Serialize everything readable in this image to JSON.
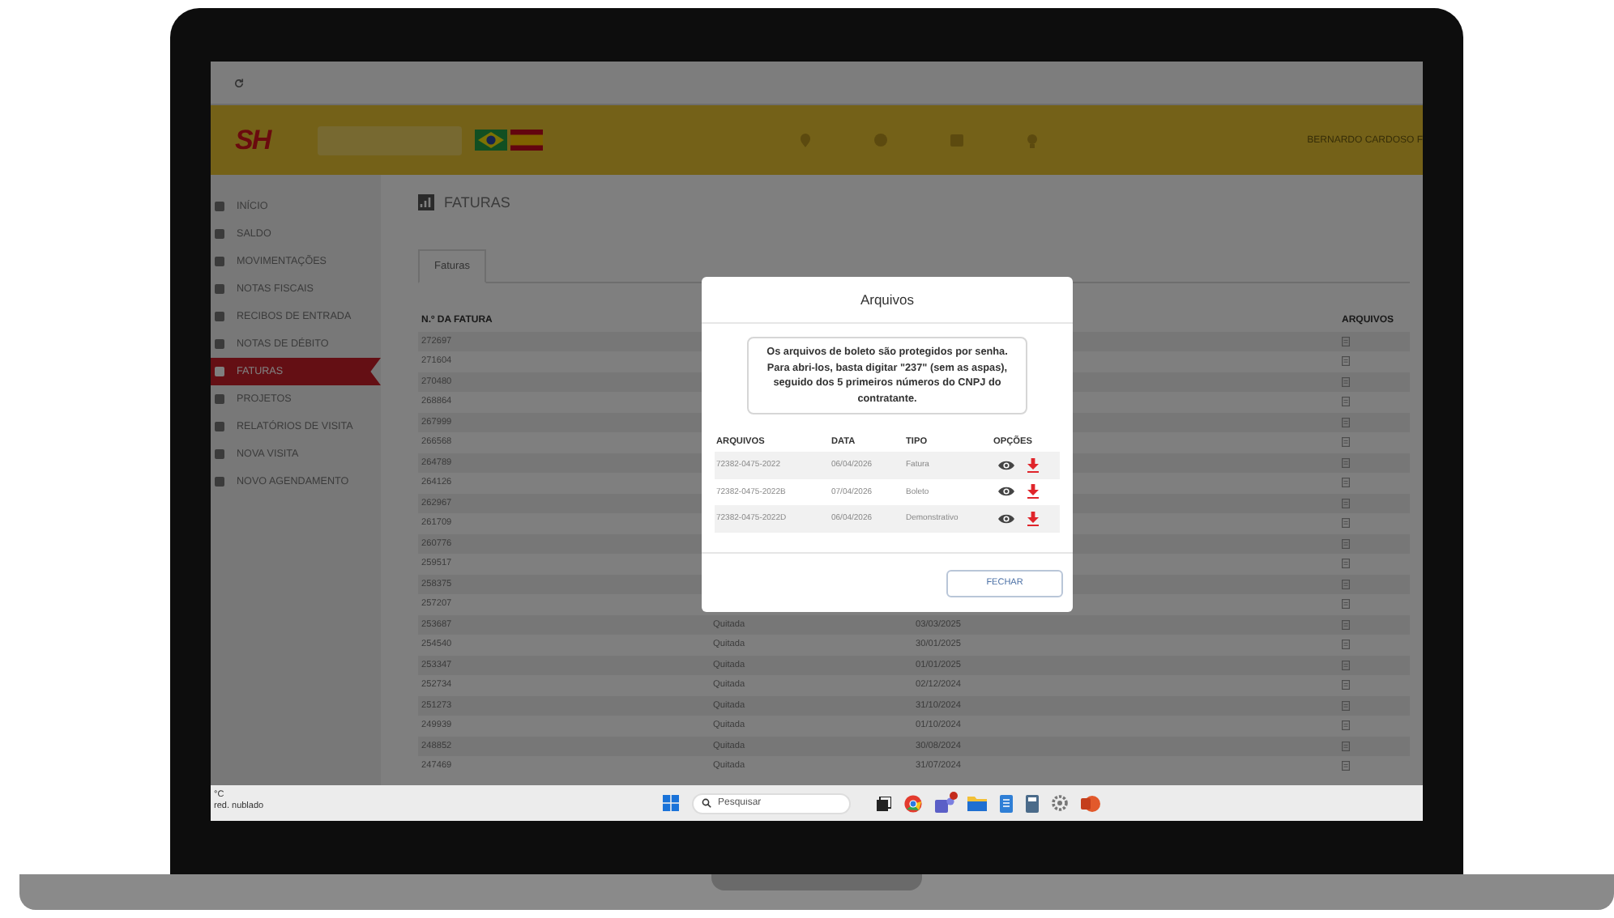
{
  "header": {
    "logo": "SH",
    "user": "BERNARDO CARDOSO F"
  },
  "sidebar": {
    "items": [
      {
        "label": "INÍCIO",
        "selected": false
      },
      {
        "label": "SALDO",
        "selected": false
      },
      {
        "label": "MOVIMENTAÇÕES",
        "selected": false
      },
      {
        "label": "NOTAS FISCAIS",
        "selected": false
      },
      {
        "label": "RECIBOS DE ENTRADA",
        "selected": false
      },
      {
        "label": "NOTAS DE DÉBITO",
        "selected": false
      },
      {
        "label": "FATURAS",
        "selected": true
      },
      {
        "label": "PROJETOS",
        "selected": false
      },
      {
        "label": "RELATÓRIOS DE VISITA",
        "selected": false
      },
      {
        "label": "NOVA VISITA",
        "selected": false
      },
      {
        "label": "NOVO AGENDAMENTO",
        "selected": false
      }
    ]
  },
  "page": {
    "title": "FATURAS",
    "tabs": [
      {
        "label": "Faturas",
        "selected": true
      }
    ]
  },
  "table": {
    "columns": [
      "N.º DA FATURA",
      "ARQUIVOS"
    ],
    "rows": [
      {
        "number": "272697"
      },
      {
        "number": "271604"
      },
      {
        "number": "270480"
      },
      {
        "number": "268864"
      },
      {
        "number": "267999"
      },
      {
        "number": "266568"
      },
      {
        "number": "264789"
      },
      {
        "number": "264126"
      },
      {
        "number": "262967"
      },
      {
        "number": "261709"
      },
      {
        "number": "260776"
      },
      {
        "number": "259517"
      },
      {
        "number": "258375"
      },
      {
        "number": "257207"
      },
      {
        "number": "253687",
        "status": "Quitada",
        "date": "03/03/2025"
      },
      {
        "number": "254540",
        "status": "Quitada",
        "date": "30/01/2025"
      },
      {
        "number": "253347",
        "status": "Quitada",
        "date": "01/01/2025"
      },
      {
        "number": "252734",
        "status": "Quitada",
        "date": "02/12/2024"
      },
      {
        "number": "251273",
        "status": "Quitada",
        "date": "31/10/2024"
      },
      {
        "number": "249939",
        "status": "Quitada",
        "date": "01/10/2024"
      },
      {
        "number": "248852",
        "status": "Quitada",
        "date": "30/08/2024"
      },
      {
        "number": "247469",
        "status": "Quitada",
        "date": "31/07/2024"
      }
    ]
  },
  "modal": {
    "title": "Arquivos",
    "notice": "Os arquivos de boleto são protegidos por senha. Para abri-los, basta digitar \"237\" (sem as aspas), seguido dos 5 primeiros números do CNPJ do contratante.",
    "columns": [
      "ARQUIVOS",
      "DATA",
      "TIPO",
      "OPÇÕES"
    ],
    "files": [
      {
        "name": "72382-0475-2022",
        "date": "06/04/2026",
        "type": "Fatura"
      },
      {
        "name": "72382-0475-2022B",
        "date": "07/04/2026",
        "type": "Boleto"
      },
      {
        "name": "72382-0475-2022D",
        "date": "06/04/2026",
        "type": "Demonstrativo"
      }
    ],
    "close_button": "FECHAR"
  },
  "taskbar": {
    "weather_temp": "°C",
    "weather_text": "red. nublado",
    "search_placeholder": "Pesquisar"
  }
}
